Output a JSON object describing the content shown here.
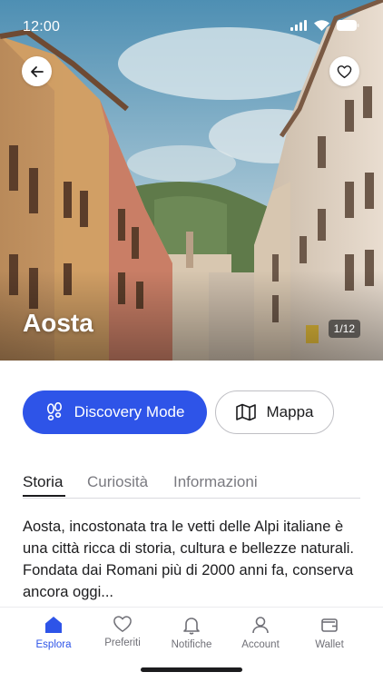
{
  "status_bar": {
    "time": "12:00"
  },
  "hero": {
    "title": "Aosta",
    "photo_counter": "1/12",
    "back_icon": "arrow-left-icon",
    "favorite_icon": "heart-icon"
  },
  "actions": {
    "discovery_label": "Discovery Mode",
    "discovery_icon": "footprints-icon",
    "map_label": "Mappa",
    "map_icon": "map-icon"
  },
  "tabs": [
    {
      "label": "Storia",
      "active": true
    },
    {
      "label": "Curiosità",
      "active": false
    },
    {
      "label": "Informazioni",
      "active": false
    }
  ],
  "description": "Aosta, incostonata tra le vetti delle Alpi italiane è una città ricca di storia, cultura e bellezze naturali. Fondata dai Romani più di 2000 anni fa, conserva ancora oggi...",
  "bottom_nav": [
    {
      "label": "Esplora",
      "icon": "home-icon",
      "active": true
    },
    {
      "label": "Preferiti",
      "icon": "heart-icon",
      "active": false
    },
    {
      "label": "Notifiche",
      "icon": "bell-icon",
      "active": false
    },
    {
      "label": "Account",
      "icon": "user-icon",
      "active": false
    },
    {
      "label": "Wallet",
      "icon": "wallet-icon",
      "active": false
    }
  ],
  "colors": {
    "accent": "#2e54e8",
    "text": "#1c1c1e",
    "muted": "#7a7a80"
  }
}
